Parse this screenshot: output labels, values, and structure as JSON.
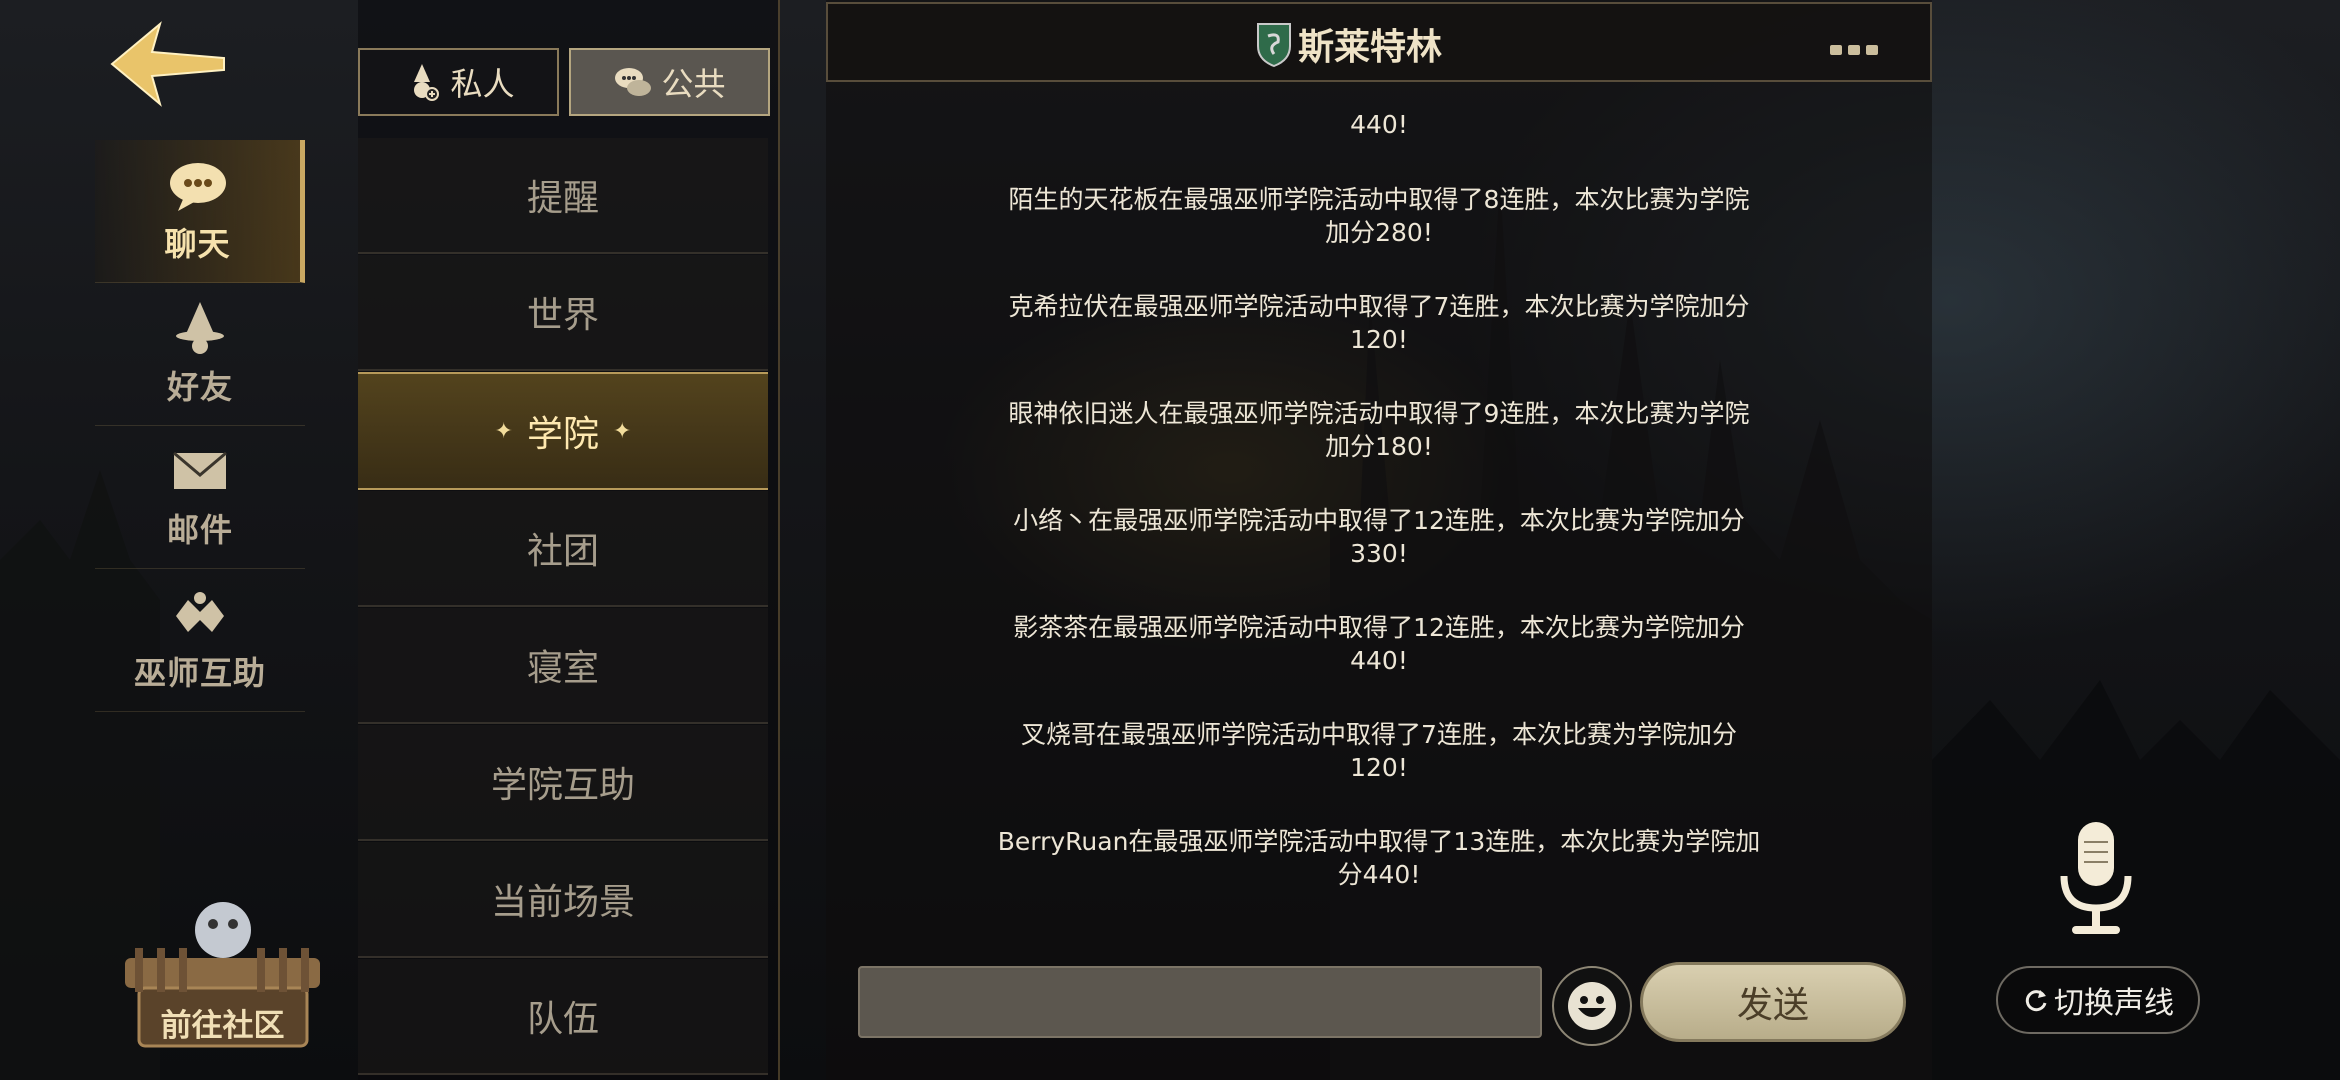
{
  "colors": {
    "accent_gold": "#c9a862",
    "active_text": "#ffe9b0",
    "message_text": "#ede6d6",
    "send_button": "#d9cfb0"
  },
  "back": {
    "icon": "back-arrow-icon"
  },
  "left_nav": {
    "items": [
      {
        "label": "聊天",
        "icon": "chat-bubble-icon",
        "active": true
      },
      {
        "label": "好友",
        "icon": "wizard-hat-icon",
        "active": false
      },
      {
        "label": "邮件",
        "icon": "envelope-icon",
        "active": false
      },
      {
        "label": "巫师互助",
        "icon": "wizard-help-icon",
        "active": false
      }
    ]
  },
  "community": {
    "label": "前往社区",
    "icon": "owl-icon"
  },
  "top_tabs": [
    {
      "label": "私人",
      "icon": "private-chat-icon",
      "active": false
    },
    {
      "label": "公共",
      "icon": "public-chat-icon",
      "active": true
    }
  ],
  "channels": [
    {
      "label": "提醒",
      "active": false
    },
    {
      "label": "世界",
      "active": false
    },
    {
      "label": "学院",
      "active": true
    },
    {
      "label": "社团",
      "active": false
    },
    {
      "label": "寝室",
      "active": false
    },
    {
      "label": "学院互助",
      "active": false
    },
    {
      "label": "当前场景",
      "active": false
    },
    {
      "label": "队伍",
      "active": false
    }
  ],
  "chat": {
    "title": "斯莱特林",
    "crest_icon": "slytherin-crest-icon",
    "more_icon": "more-dots-icon",
    "messages": [
      {
        "lines": [
          "440!"
        ]
      },
      {
        "lines": [
          "陌生的天花板在最强巫师学院活动中取得了8连胜，本次比赛为学院",
          "加分280!"
        ]
      },
      {
        "lines": [
          "克希拉伏在最强巫师学院活动中取得了7连胜，本次比赛为学院加分",
          "120!"
        ]
      },
      {
        "lines": [
          "眼神依旧迷人在最强巫师学院活动中取得了9连胜，本次比赛为学院",
          "加分180!"
        ]
      },
      {
        "lines": [
          "小络丶在最强巫师学院活动中取得了12连胜，本次比赛为学院加分",
          "330!"
        ]
      },
      {
        "lines": [
          "影茶茶在最强巫师学院活动中取得了12连胜，本次比赛为学院加分",
          "440!"
        ]
      },
      {
        "lines": [
          "叉烧哥在最强巫师学院活动中取得了7连胜，本次比赛为学院加分",
          "120!"
        ]
      },
      {
        "lines": [
          "BerryRuan在最强巫师学院活动中取得了13连胜，本次比赛为学院加",
          "分440!"
        ]
      }
    ],
    "input_value": "",
    "emoji_icon": "smiley-icon",
    "send_label": "发送"
  },
  "voice": {
    "mic_icon": "microphone-icon",
    "switch_label": "切换声线",
    "switch_icon": "refresh-icon"
  }
}
